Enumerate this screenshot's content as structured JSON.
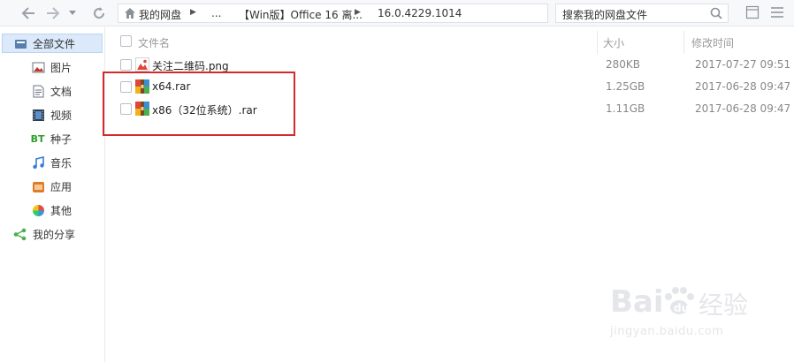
{
  "toolbar": {
    "breadcrumbs": [
      "我的网盘",
      "...",
      "【Win版】Office 16 离...",
      "16.0.4229.1014"
    ],
    "search_placeholder": "搜索我的网盘文件"
  },
  "sidebar": {
    "items": [
      {
        "label": "全部文件",
        "icon": "folder-icon",
        "selected": true
      },
      {
        "label": "图片",
        "icon": "image-icon",
        "selected": false
      },
      {
        "label": "文档",
        "icon": "document-icon",
        "selected": false
      },
      {
        "label": "视频",
        "icon": "video-icon",
        "selected": false
      },
      {
        "label": "种子",
        "icon": "bt-icon",
        "selected": false
      },
      {
        "label": "音乐",
        "icon": "music-icon",
        "selected": false
      },
      {
        "label": "应用",
        "icon": "app-icon",
        "selected": false
      },
      {
        "label": "其他",
        "icon": "other-icon",
        "selected": false
      },
      {
        "label": "我的分享",
        "icon": "share-icon",
        "selected": false
      }
    ]
  },
  "file_list": {
    "columns": {
      "name": "文件名",
      "size": "大小",
      "modified": "修改时间"
    },
    "rows": [
      {
        "name": "关注二维码.png",
        "size": "280KB",
        "modified": "2017-07-27 09:51",
        "type": "image"
      },
      {
        "name": "x64.rar",
        "size": "1.25GB",
        "modified": "2017-06-28 09:47",
        "type": "archive"
      },
      {
        "name": "x86（32位系统）.rar",
        "size": "1.11GB",
        "modified": "2017-06-28 09:47",
        "type": "archive"
      }
    ]
  },
  "watermark": {
    "brand": "Bai",
    "brand_cn": "经验",
    "url": "jingyan.baidu.com"
  },
  "colors": {
    "highlight": "#d42a2a",
    "selected_bg": "#dbe9fb"
  }
}
